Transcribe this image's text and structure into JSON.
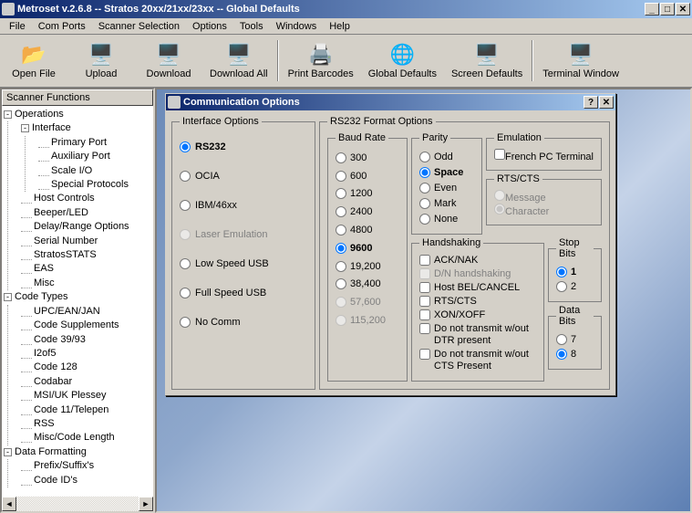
{
  "title": "Metroset v.2.6.8 -- Stratos 20xx/21xx/23xx -- Global Defaults",
  "menubar": [
    "File",
    "Com Ports",
    "Scanner Selection",
    "Options",
    "Tools",
    "Windows",
    "Help"
  ],
  "toolbar": [
    {
      "label": "Open File",
      "icon": "📂"
    },
    {
      "label": "Upload",
      "icon": "🖥️"
    },
    {
      "label": "Download",
      "icon": "🖥️"
    },
    {
      "label": "Download All",
      "icon": "🖥️"
    },
    {
      "label": "Print Barcodes",
      "icon": "🖨️"
    },
    {
      "label": "Global Defaults",
      "icon": "🌐"
    },
    {
      "label": "Screen Defaults",
      "icon": "🖥️"
    },
    {
      "label": "Terminal Window",
      "icon": "🖥️"
    }
  ],
  "tree_header": "Scanner Functions",
  "tree": {
    "operations": {
      "label": "Operations",
      "children": {
        "interface": {
          "label": "Interface",
          "children": [
            "Primary Port",
            "Auxiliary Port",
            "Scale I/O",
            "Special Protocols"
          ]
        },
        "others": [
          "Host Controls",
          "Beeper/LED",
          "Delay/Range Options",
          "Serial Number",
          "StratosSTATS",
          "EAS",
          "Misc"
        ]
      }
    },
    "codetypes": {
      "label": "Code Types",
      "children": [
        "UPC/EAN/JAN",
        "Code Supplements",
        "Code 39/93",
        "I2of5",
        "Code 128",
        "Codabar",
        "MSI/UK Plessey",
        "Code 11/Telepen",
        "RSS",
        "Misc/Code Length"
      ]
    },
    "dataformat": {
      "label": "Data Formatting",
      "children": [
        "Prefix/Suffix's",
        "Code ID's"
      ]
    }
  },
  "child_title": "Communication Options",
  "iface": {
    "legend": "Interface Options",
    "opts": [
      {
        "label": "RS232",
        "sel": true,
        "bold": true
      },
      {
        "label": "OCIA"
      },
      {
        "label": "IBM/46xx"
      },
      {
        "label": "Laser Emulation",
        "disabled": true
      },
      {
        "label": "Low Speed USB"
      },
      {
        "label": "Full Speed USB"
      },
      {
        "label": "No Comm"
      }
    ]
  },
  "rs232": {
    "legend": "RS232 Format Options",
    "baud": {
      "legend": "Baud Rate",
      "opts": [
        {
          "label": "300"
        },
        {
          "label": "600"
        },
        {
          "label": "1200"
        },
        {
          "label": "2400"
        },
        {
          "label": "4800"
        },
        {
          "label": "9600",
          "sel": true,
          "bold": true
        },
        {
          "label": "19,200"
        },
        {
          "label": "38,400"
        },
        {
          "label": "57,600",
          "disabled": true
        },
        {
          "label": "115,200",
          "disabled": true
        }
      ]
    },
    "parity": {
      "legend": "Parity",
      "opts": [
        {
          "label": "Odd"
        },
        {
          "label": "Space",
          "sel": true,
          "bold": true
        },
        {
          "label": "Even"
        },
        {
          "label": "Mark"
        },
        {
          "label": "None"
        }
      ]
    },
    "emulation": {
      "legend": "Emulation",
      "opts": [
        {
          "label": "French PC Terminal",
          "type": "check"
        }
      ]
    },
    "rtscts": {
      "legend": "RTS/CTS",
      "opts": [
        {
          "label": "Message",
          "disabled": true
        },
        {
          "label": "Character",
          "sel": true,
          "disabled": true
        }
      ]
    },
    "hand": {
      "legend": "Handshaking",
      "opts": [
        {
          "label": "ACK/NAK",
          "type": "check"
        },
        {
          "label": "D/N handshaking",
          "type": "check",
          "disabled": true
        },
        {
          "label": "Host BEL/CANCEL",
          "type": "check"
        },
        {
          "label": "RTS/CTS",
          "type": "check"
        },
        {
          "label": "XON/XOFF",
          "type": "check"
        },
        {
          "label": "Do not transmit w/out DTR present",
          "type": "check"
        },
        {
          "label": "Do not transmit w/out CTS Present",
          "type": "check"
        }
      ]
    },
    "stop": {
      "legend": "Stop Bits",
      "opts": [
        {
          "label": "1",
          "sel": true,
          "bold": true
        },
        {
          "label": "2"
        }
      ]
    },
    "data": {
      "legend": "Data Bits",
      "opts": [
        {
          "label": "7"
        },
        {
          "label": "8",
          "sel": true
        }
      ]
    }
  }
}
